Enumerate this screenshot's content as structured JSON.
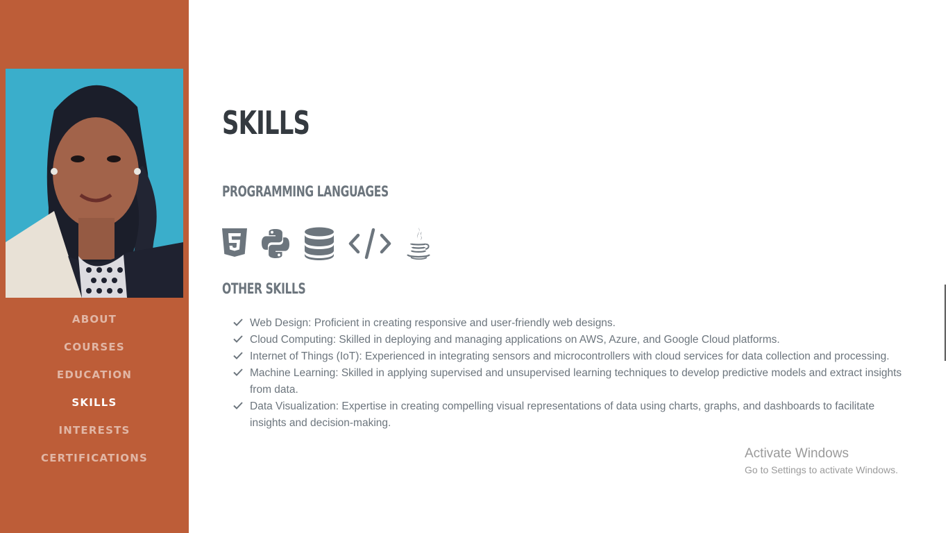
{
  "sidebar": {
    "background": "#bd5d38",
    "nav": [
      {
        "label": "ABOUT",
        "active": false
      },
      {
        "label": "COURSES",
        "active": false
      },
      {
        "label": "EDUCATION",
        "active": false
      },
      {
        "label": "SKILLS",
        "active": true
      },
      {
        "label": "INTERESTS",
        "active": false
      },
      {
        "label": "CERTIFICATIONS",
        "active": false
      }
    ]
  },
  "main": {
    "title": "SKILLS",
    "programming_heading": "PROGRAMMING LANGUAGES",
    "language_icons": [
      "html5-icon",
      "python-icon",
      "database-icon",
      "code-icon",
      "java-icon"
    ],
    "other_heading": "OTHER SKILLS",
    "other_skills": [
      "Web Design: Proficient in creating responsive and user-friendly web designs.",
      "Cloud Computing: Skilled in deploying and managing applications on AWS, Azure, and Google Cloud platforms.",
      "Internet of Things (IoT): Experienced in integrating sensors and microcontrollers with cloud services for data collection and processing.",
      "Machine Learning: Skilled in applying supervised and unsupervised learning techniques to develop predictive models and extract insights from data.",
      "Data Visualization: Expertise in creating compelling visual representations of data using charts, graphs, and dashboards to facilitate insights and decision-making."
    ]
  },
  "watermark": {
    "title": "Activate Windows",
    "subtitle": "Go to Settings to activate Windows."
  },
  "colors": {
    "accent": "#bd5d38",
    "heading": "#343a40",
    "muted": "#6c757d"
  }
}
